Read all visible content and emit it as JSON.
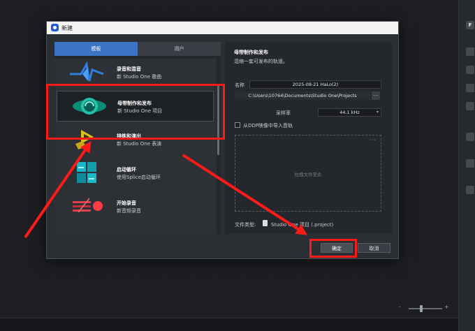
{
  "dialog": {
    "title": "新建",
    "tabs": [
      {
        "label": "模板",
        "selected": true
      },
      {
        "label": "用户",
        "selected": false
      }
    ],
    "template_list": [
      {
        "title": "录音和混音",
        "subtitle": "新 Studio One 歌曲"
      },
      {
        "title": "母带制作和发布",
        "subtitle": "新 Studio One 项目",
        "selected": true
      },
      {
        "title": "排练和演出",
        "subtitle": "新 Studio One 表演"
      },
      {
        "title": "启动循环",
        "subtitle": "使用Splice启动循环"
      },
      {
        "title": "开始录音",
        "subtitle": "新音频录音"
      }
    ],
    "details": {
      "title": "母带制作和发布",
      "description": "混缩一套可发布的轨道。",
      "name_label": "名称",
      "name_value": "2025-08-21 HaLo(2)",
      "path_value": "C:\\Users\\10764\\Documents\\Studio One\\Projects",
      "browse_label": "...",
      "samplerate_label": "采样率",
      "samplerate_value": "44.1 kHz",
      "ddp_label": "从DDP映像中导入音轨",
      "ddp_checked": false,
      "dropzone_text": "拉拽文件至此",
      "dropzone_menu": "···",
      "filetype_label": "文件类型:",
      "filetype_value": "Studio One 项目 (.project)"
    },
    "buttons": {
      "ok": "确定",
      "cancel": "取消"
    }
  },
  "background": {
    "right_panel_label": "F",
    "zoom_minus": "-",
    "zoom_plus": "+"
  },
  "colors": {
    "accent": "#3c74c4",
    "annotation": "#ff1a1a"
  }
}
